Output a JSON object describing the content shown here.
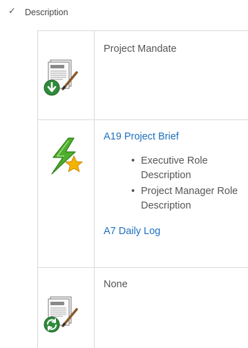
{
  "header": {
    "check_glyph": "✓",
    "column_label": "Description"
  },
  "rows": [
    {
      "icon": "document-download-icon",
      "text": "Project Mandate"
    },
    {
      "icon": "lightning-star-icon",
      "link_primary": "A19 Project Brief",
      "bullets": [
        "Executive Role Description",
        "Project Manager Role Description"
      ],
      "link_secondary": "A7 Daily Log"
    },
    {
      "icon": "document-sync-icon",
      "text": "None"
    }
  ],
  "colors": {
    "link": "#1c6fbf",
    "grid": "#d9d9d9",
    "icon_green": "#2e8b3a",
    "star_yellow": "#f4b400"
  }
}
